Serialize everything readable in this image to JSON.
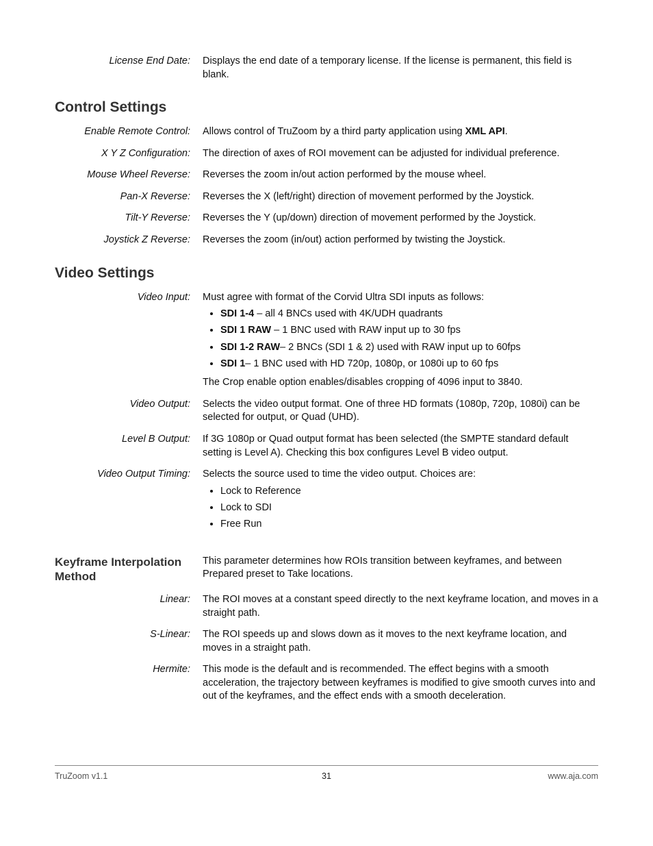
{
  "top_item": {
    "label": "License End Date:",
    "desc": "Displays the end date of a temporary license. If the license is permanent, this field is blank."
  },
  "control": {
    "heading": "Control Settings",
    "items": [
      {
        "label": "Enable Remote Control:",
        "desc_pre": "Allows control of TruZoom by a third party application using ",
        "desc_bold": "XML API",
        "desc_post": "."
      },
      {
        "label": "X Y Z Configuration:",
        "desc": "The direction of axes of ROI movement can be adjusted for individual preference."
      },
      {
        "label": "Mouse Wheel Reverse:",
        "desc": "Reverses the zoom in/out action performed by the mouse wheel."
      },
      {
        "label": "Pan-X Reverse:",
        "desc": "Reverses the X (left/right) direction of movement performed by the Joystick."
      },
      {
        "label": "Tilt-Y Reverse:",
        "desc": "Reverses the Y (up/down) direction of movement performed by the Joystick."
      },
      {
        "label": "Joystick Z Reverse:",
        "desc": "Reverses the zoom (in/out) action performed by twisting the Joystick."
      }
    ]
  },
  "video": {
    "heading": "Video Settings",
    "input": {
      "label": "Video Input:",
      "intro": "Must agree with format of the Corvid Ultra SDI inputs as follows:",
      "bullets": [
        {
          "b": "SDI 1-4",
          "rest": " – all 4 BNCs used with 4K/UDH quadrants"
        },
        {
          "b": "SDI 1 RAW",
          "rest": " – 1 BNC used with RAW input up to 30 fps"
        },
        {
          "b": "SDI 1-2 RAW",
          "rest": "– 2 BNCs (SDI 1 & 2) used with RAW input up to 60fps"
        },
        {
          "b": "SDI 1",
          "rest": "– 1 BNC used with HD 720p, 1080p, or 1080i up to 60 fps"
        }
      ],
      "crop": "The Crop enable option enables/disables cropping of 4096 input to 3840."
    },
    "output": {
      "label": "Video Output:",
      "desc": "Selects the video output format. One of three HD formats (1080p, 720p, 1080i) can be selected for output, or Quad (UHD)."
    },
    "levelb": {
      "label": "Level B Output:",
      "desc": "If 3G 1080p or Quad output format has been selected (the SMPTE standard default setting is Level A). Checking this box configures Level B video output."
    },
    "timing": {
      "label": "Video Output Timing:",
      "intro": "Selects the source used to time the video output. Choices are:",
      "bullets": [
        "Lock to Reference",
        "Lock to SDI",
        "Free Run"
      ]
    }
  },
  "keyframe": {
    "heading": "Keyframe Interpolation Method",
    "intro": "This parameter determines how ROIs transition between keyframes, and between Prepared preset to Take locations.",
    "items": [
      {
        "label": "Linear:",
        "desc": "The ROI moves at a constant speed directly to the next keyframe location, and moves in a straight path."
      },
      {
        "label": "S-Linear:",
        "desc": "The ROI speeds up and slows down as it moves to the next keyframe location, and moves in a straight path."
      },
      {
        "label": "Hermite:",
        "desc": "This mode is the default and is recommended. The effect begins with a smooth acceleration, the trajectory between keyframes is modified to give smooth curves into and out of the keyframes, and the effect ends with a smooth deceleration."
      }
    ]
  },
  "footer": {
    "left": "TruZoom v1.1",
    "center": "31",
    "right": "www.aja.com"
  }
}
